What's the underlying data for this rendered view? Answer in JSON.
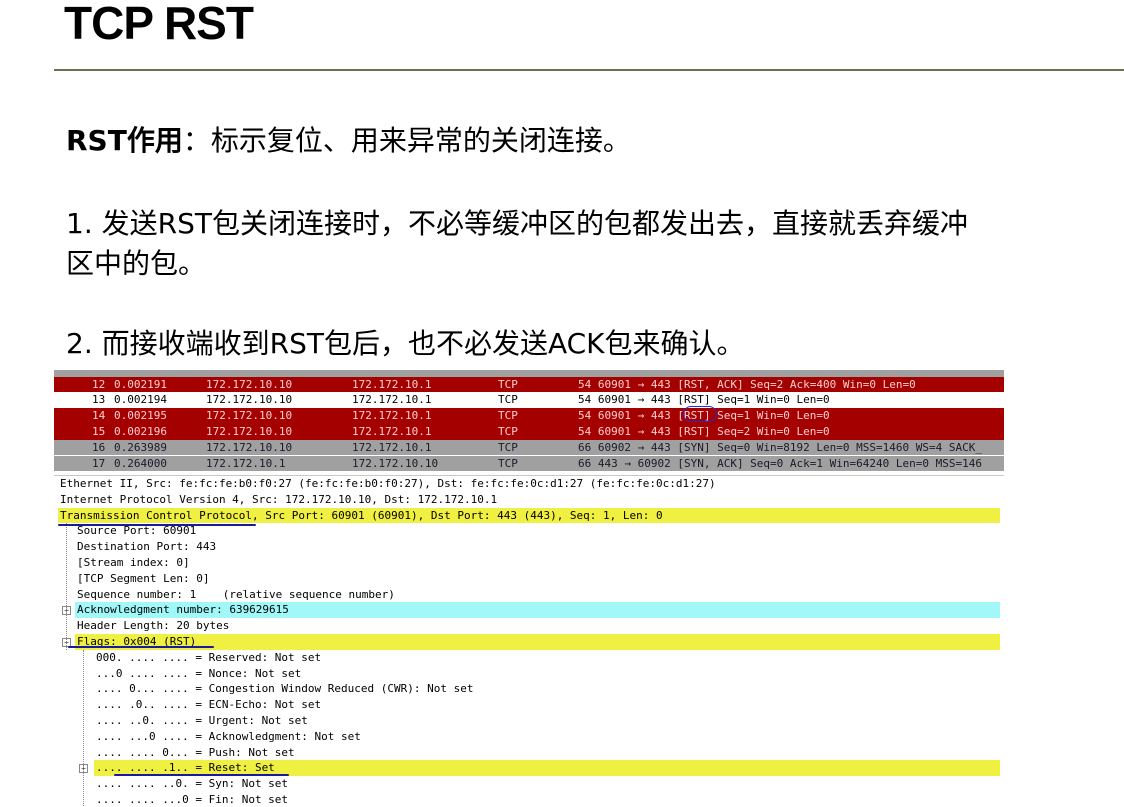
{
  "slide": {
    "title": "TCP RST",
    "line1_bold": "RST作用",
    "line1_rest": "：标示复位、用来异常的关闭连接。",
    "point1_a": "1. 发送RST包关闭连接时，不必等缓冲区的包都发出去，直接就丢弃缓冲",
    "point1_b": "区中的包。",
    "point2": "2. 而接收端收到RST包后，也不必发送ACK包来确认。"
  },
  "packets": [
    {
      "no": "12",
      "time": "0.002191",
      "src": "172.172.10.10",
      "dst": "172.172.10.1",
      "proto": "TCP",
      "info": "54 60901 → 443 [RST, ACK] Seq=2 Ack=400 Win=0 Len=0",
      "style": "red"
    },
    {
      "no": "13",
      "time": "0.002194",
      "src": "172.172.10.10",
      "dst": "172.172.10.1",
      "proto": "TCP",
      "info": "54 60901 → 443 [RST] Seq=1 Win=0 Len=0",
      "style": "plain"
    },
    {
      "no": "14",
      "time": "0.002195",
      "src": "172.172.10.10",
      "dst": "172.172.10.1",
      "proto": "TCP",
      "info": "54 60901 → 443 [RST] Seq=1 Win=0 Len=0",
      "style": "red"
    },
    {
      "no": "15",
      "time": "0.002196",
      "src": "172.172.10.10",
      "dst": "172.172.10.1",
      "proto": "TCP",
      "info": "54 60901 → 443 [RST] Seq=2 Win=0 Len=0",
      "style": "red"
    },
    {
      "no": "16",
      "time": "0.263989",
      "src": "172.172.10.10",
      "dst": "172.172.10.1",
      "proto": "TCP",
      "info": "66 60902 → 443 [SYN] Seq=0 Win=8192 Len=0 MSS=1460 WS=4 SACK_",
      "style": "gray"
    },
    {
      "no": "17",
      "time": "0.264000",
      "src": "172.172.10.1",
      "dst": "172.172.10.10",
      "proto": "TCP",
      "info": "66 443 → 60902 [SYN, ACK] Seq=0 Ack=1 Win=64240 Len=0 MSS=146",
      "style": "gray"
    }
  ],
  "tree": [
    {
      "text": "Ethernet II, Src: fe:fc:fe:b0:f0:27 (fe:fc:fe:b0:f0:27), Dst: fe:fc:fe:0c:d1:27 (fe:fc:fe:0c:d1:27)",
      "level": 0,
      "hl": ""
    },
    {
      "text": "Internet Protocol Version 4, Src: 172.172.10.10, Dst: 172.172.10.1",
      "level": 0,
      "hl": ""
    },
    {
      "text": "Transmission Control Protocol, Src Port: 60901 (60901), Dst Port: 443 (443), Seq: 1, Len: 0",
      "level": 0,
      "hl": "y"
    },
    {
      "text": "Source Port: 60901",
      "level": 1,
      "hl": ""
    },
    {
      "text": "Destination Port: 443",
      "level": 1,
      "hl": ""
    },
    {
      "text": "[Stream index: 0]",
      "level": 1,
      "hl": ""
    },
    {
      "text": "[TCP Segment Len: 0]",
      "level": 1,
      "hl": ""
    },
    {
      "text": "Sequence number: 1    (relative sequence number)",
      "level": 1,
      "hl": ""
    },
    {
      "text": "Acknowledgment number: 639629615",
      "level": 1,
      "hl": "c",
      "expander": "+"
    },
    {
      "text": "Header Length: 20 bytes",
      "level": 1,
      "hl": ""
    },
    {
      "text": "Flags: 0x004 (RST)",
      "level": 1,
      "hl": "y",
      "expander": "−"
    },
    {
      "text": "000. .... .... = Reserved: Not set",
      "level": 2,
      "hl": ""
    },
    {
      "text": "...0 .... .... = Nonce: Not set",
      "level": 2,
      "hl": ""
    },
    {
      "text": ".... 0... .... = Congestion Window Reduced (CWR): Not set",
      "level": 2,
      "hl": ""
    },
    {
      "text": ".... .0.. .... = ECN-Echo: Not set",
      "level": 2,
      "hl": ""
    },
    {
      "text": ".... ..0. .... = Urgent: Not set",
      "level": 2,
      "hl": ""
    },
    {
      "text": ".... ...0 .... = Acknowledgment: Not set",
      "level": 2,
      "hl": ""
    },
    {
      "text": ".... .... 0... = Push: Not set",
      "level": 2,
      "hl": ""
    },
    {
      "text": ".... .... .1.. = Reset: Set",
      "level": 2,
      "hl": "y",
      "expander": "+"
    },
    {
      "text": ".... .... ..0. = Syn: Not set",
      "level": 2,
      "hl": ""
    },
    {
      "text": ".... .... ...0 = Fin: Not set",
      "level": 2,
      "hl": ""
    }
  ],
  "colors": {
    "red_row": "#a40000",
    "gray_row": "#a0a0a0",
    "yellow": "#f0f042",
    "cyan": "#a0f8f8",
    "annotation": "#1a1aa0"
  }
}
